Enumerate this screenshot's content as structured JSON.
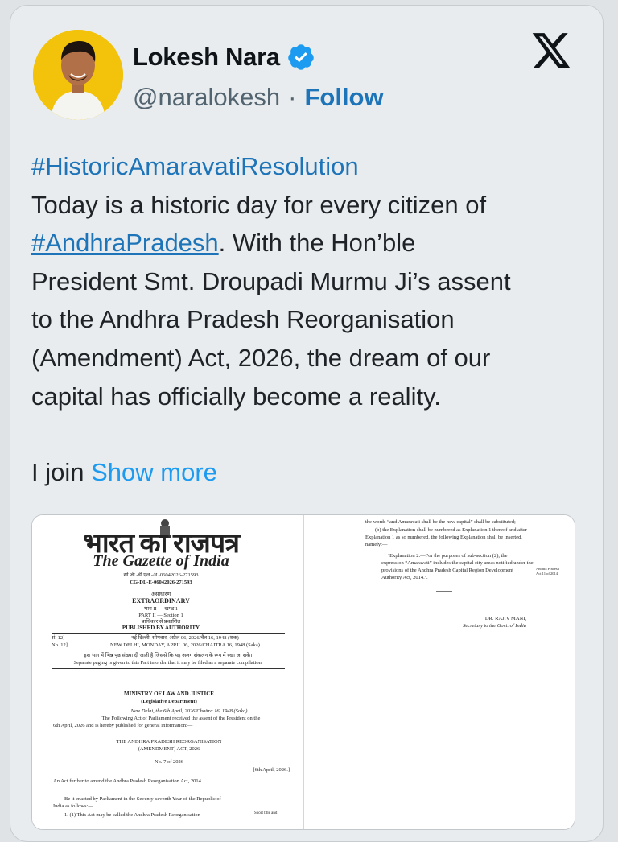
{
  "colors": {
    "link": "#1d74b8",
    "show_more": "#1d9bf0",
    "verified": "#1d9bf0",
    "avatar_bg": "#f2c30a"
  },
  "header": {
    "name": "Lokesh Nara",
    "handle": "@naralokesh",
    "separator": "·",
    "follow_label": "Follow",
    "verified_icon": "verified-badge-icon",
    "platform_icon": "x-logo-icon"
  },
  "tweet": {
    "hashtag_top": "#HistoricAmaravatiResolution",
    "line1": "Today is a historic day for every citizen of",
    "hashtag_ap": "#AndhraPradesh",
    "line2_rest": ". With the Hon’ble",
    "line3": "President Smt. Droupadi Murmu Ji’s assent",
    "line4": "to the Andhra Pradesh Reorganisation",
    "line5": "(Amendment) Act, 2026, the dream of our",
    "line6": "capital has officially become a reality.",
    "truncated": "I join",
    "show_more": "Show more"
  },
  "gazette": {
    "hindi_title": "भारत का राजपत्र",
    "english_title": "The Gazette of India",
    "reg_hindi": "सी.जी.-डी.एल.-अ.-06042026-271593",
    "reg_english": "CG-DL-E-06042026-271593",
    "extraordinary_hindi": "असाधारण",
    "extraordinary": "EXTRAORDINARY",
    "part_hindi": "भाग II — खण्ड 1",
    "part": "PART II — Section 1",
    "authority_hindi": "प्राधिकार से प्रकाशित",
    "authority": "PUBLISHED BY AUTHORITY",
    "no_hindi": "सं. 12]",
    "date_hindi": "नई दिल्ली, सोमवार, अप्रैल 06, 2026/चैत्र 16, 1948 (शक)",
    "no": "No. 12]",
    "date": "NEW DELHI, MONDAY, APRIL 06, 2026/CHAITRA 16, 1948 (Saka)",
    "note_hindi": "इस भाग में भिन्न पृष्ठ संख्या दी जाती है जिससे कि यह अलग संकलन के रूप में रखा जा सके।",
    "note": "Separate paging is given to this Part in order that it may be filed as a separate compilation.",
    "ministry": "MINISTRY OF LAW AND JUSTICE",
    "department": "(Legislative Department)",
    "dateline": "New Delhi, the 6th April, 2026/Chaitra 16, 1948 (Saka)",
    "assent_1": "The Following Act of Parliament received the assent of the President on the",
    "assent_2": "6th April, 2026 and is hereby published for general information:—",
    "act_title_1": "THE ANDHRA PRADESH REORGANISATION",
    "act_title_2": "(AMENDMENT) ACT, 2026",
    "act_no": "No. 7 of 2026",
    "act_date": "[6th April, 2026.]",
    "long_title": "An Act further to amend the Andhra Pradesh Reorganisation Act, 2014.",
    "enact_1": "Be it enacted by Parliament in the Seventy-seventh Year of the Republic of",
    "enact_2": "India as follows:—",
    "section1": "1. (1) This Act may be called the Andhra Pradesh Reorganisation",
    "margin_short_title": "Short title and",
    "p2_line1": "the words “and Amaravati shall be the new capital” shall be substituted;",
    "p2_line2": "(b) the Explanation shall be numbered as Explanation 1 thereof and after",
    "p2_line3": "Explanation 1 as so numbered, the following Explanation shall be inserted,",
    "p2_line4": "namely:—",
    "p2_expl_1": "‘Explanation 2.—For the purposes of sub-section (2), the",
    "p2_expl_2": "expression “Amaravati” includes the capital city areas notified under the",
    "p2_expl_3": "provisions of the Andhra Pradesh Capital Region Development",
    "p2_expl_4": "Authority Act, 2014.’.",
    "p2_margin_1": "Andhra Pradesh",
    "p2_margin_2": "Act 11 of 2014.",
    "signatory": "DR. RAJIV MANI,",
    "signatory_title": "Secretary to the Govt. of India"
  }
}
